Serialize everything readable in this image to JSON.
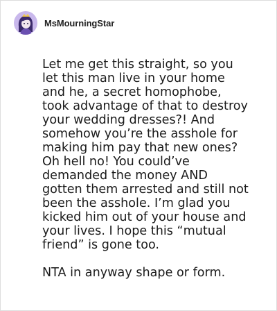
{
  "post": {
    "username": "MsMourningStar",
    "avatar_icon": "cartoon-avatar-icon",
    "colors": {
      "avatar_background": "#a58bd8",
      "text": "#1a1a1a",
      "border": "#dddddd"
    },
    "comment_lines": [
      "Let me get this straight, so you",
      "let this man live in your home",
      "and he, a secret homophobe,",
      "took advantage of that to destroy",
      "your wedding dresses?! And",
      "somehow you’re the asshole for",
      "making him pay that new ones?",
      "Oh hell no! You could’ve",
      "demanded the money AND",
      "gotten them arrested and still not",
      "been the asshole. I’m glad you",
      "kicked him out of your house and",
      "your lives. I hope this “mutual",
      "friend” is gone too."
    ],
    "verdict_line": "NTA in anyway shape or form."
  }
}
